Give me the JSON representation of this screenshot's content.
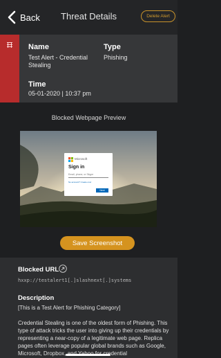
{
  "header": {
    "back_label": "Back",
    "title": "Threat Details",
    "delete_label": "Delete Alert"
  },
  "threat": {
    "name_label": "Name",
    "name_value": "Test Alert - Credential Stealing",
    "type_label": "Type",
    "type_value": "Phishing",
    "time_label": "Time",
    "time_value": "05-01-2020 | 10:37  pm"
  },
  "preview": {
    "title": "Blocked Webpage Preview",
    "dialog": {
      "brand": "Microsoft",
      "heading": "Sign in",
      "placeholder": "Email, phone, or Skype",
      "no_account": "No account? Create one!",
      "next": "Next"
    },
    "save_label": "Save Screenshot"
  },
  "blocked": {
    "url_label": "Blocked URL",
    "url_value": "hxxp://testalert1[.]slashnext[.]systems"
  },
  "description": {
    "label": "Description",
    "line1": "[This is a Test Alert for Phishing Category]",
    "body": "Credential Stealing is one of the oldest form of Phishing. This type of attack tricks the user into giving up their credentials by representing a near-copy of a legitimate web page. Replica pages often leverage popular global brands such as Google, Microsoft, Dropbox, and Yahoo for credential"
  },
  "colors": {
    "accent_red": "#b72c2c",
    "accent_gold": "#d5931f",
    "background": "#1e1f21"
  },
  "icons": [
    "chevron-left-icon",
    "flag-icon",
    "microsoft-logo-icon",
    "link-icon"
  ]
}
